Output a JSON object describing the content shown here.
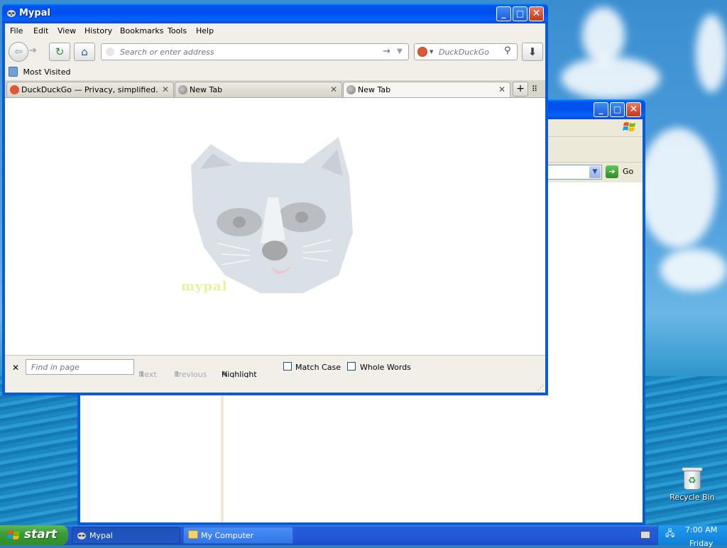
{
  "desktop": {
    "recycle_bin_label": "Recycle Bin"
  },
  "mypal_window": {
    "title": "Mypal",
    "menu": [
      "File",
      "Edit",
      "View",
      "History",
      "Bookmarks",
      "Tools",
      "Help"
    ],
    "url_placeholder": "Search or enter address",
    "search_placeholder": "DuckDuckGo",
    "bookmarks": {
      "most_visited": "Most Visited"
    },
    "tabs": [
      {
        "label": "DuckDuckGo — Privacy, simplified.",
        "active": false
      },
      {
        "label": "New Tab",
        "active": false
      },
      {
        "label": "New Tab",
        "active": true
      }
    ],
    "logo_text": "mypal",
    "findbar": {
      "placeholder": "Find in page",
      "next": "Next",
      "previous": "Previous",
      "highlight_all": "Highlight All",
      "match_case": "Match Case",
      "whole_words": "Whole Words"
    }
  },
  "mycomputer_window": {
    "go_label": "Go"
  },
  "taskbar": {
    "start_label": "start",
    "buttons": [
      {
        "label": "Mypal"
      },
      {
        "label": "My Computer"
      }
    ],
    "clock_time": "7:00 AM",
    "clock_day": "Friday"
  },
  "colors": {
    "xp_blue": "#0a5bd6",
    "start_green": "#3c9c37",
    "close_red": "#c2381f"
  }
}
